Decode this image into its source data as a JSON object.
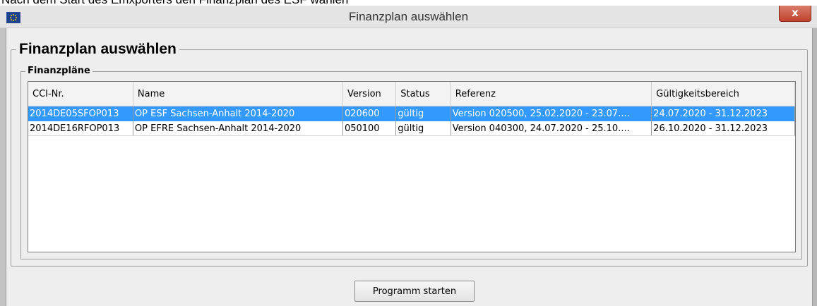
{
  "caption_above": "Nach dem Start des Emxporters den Finanzplan des ESF wählen",
  "window": {
    "title": "Finanzplan auswählen",
    "close_label": "x"
  },
  "groups": {
    "outer_title": "Finanzplan auswählen",
    "inner_title": "Finanzpläne"
  },
  "table": {
    "columns": [
      "CCI-Nr.",
      "Name",
      "Version",
      "Status",
      "Referenz",
      "Gültigkeitsbereich"
    ],
    "rows": [
      {
        "cci": "2014DE05SFOP013",
        "name": "OP ESF Sachsen-Anhalt 2014-2020",
        "version": "020600",
        "status": "gültig",
        "referenz": "Version 020500,  25.02.2020 - 23.07....",
        "gueltigkeit": "24.07.2020 - 31.12.2023",
        "selected": true
      },
      {
        "cci": "2014DE16RFOP013",
        "name": "OP EFRE Sachsen-Anhalt 2014-2020",
        "version": "050100",
        "status": "gültig",
        "referenz": "Version 040300,  24.07.2020 - 25.10....",
        "gueltigkeit": "26.10.2020 - 31.12.2023",
        "selected": false
      }
    ]
  },
  "buttons": {
    "start_label": "Programm starten"
  },
  "colors": {
    "selection": "#3399ff",
    "close_button": "#c0432d"
  },
  "icons": {
    "app_icon": "eu-flag-icon",
    "close_icon": "close-icon"
  }
}
